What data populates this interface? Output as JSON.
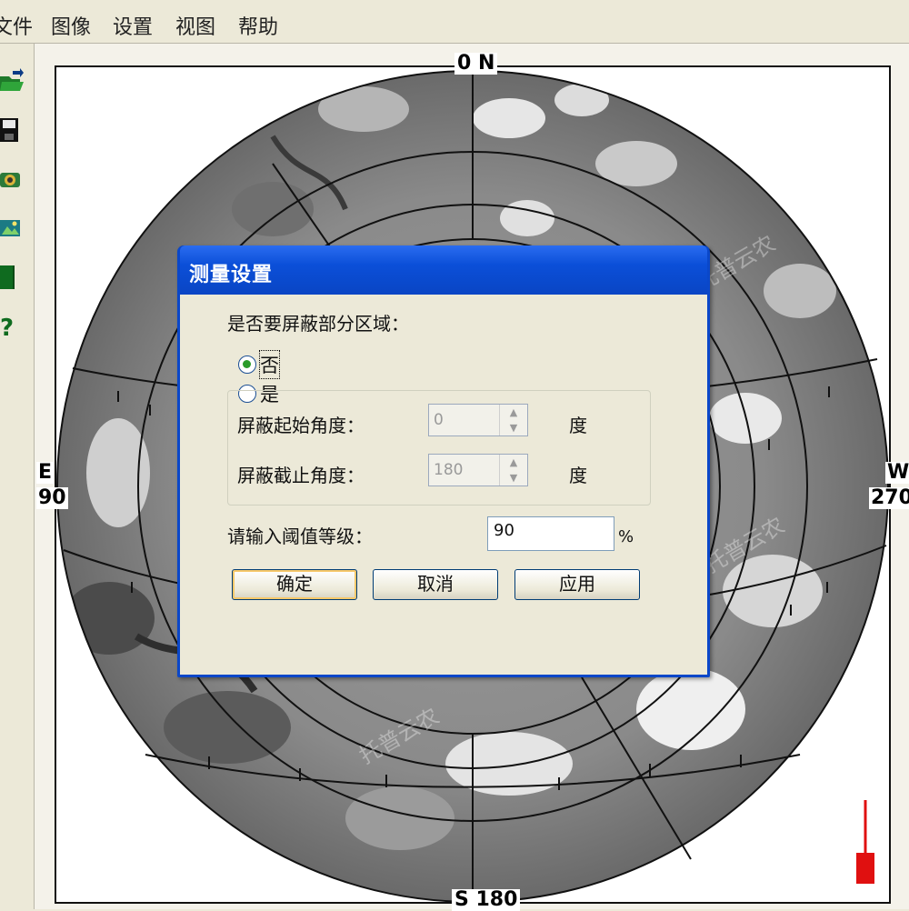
{
  "menubar": {
    "items": [
      "文件",
      "图像",
      "设置",
      "视图",
      "帮助"
    ]
  },
  "toolbar": {
    "icons": [
      "open-folder-icon",
      "save-icon",
      "camera-icon",
      "image-icon",
      "book-icon",
      "help-icon"
    ]
  },
  "plot": {
    "north_label": "0 N",
    "south_label": "S 180",
    "east_letter": "E",
    "east_value": "90",
    "west_letter": "W",
    "west_value": "270"
  },
  "watermark": "托普云农",
  "dialog": {
    "title": "测量设置",
    "question": "是否要屏蔽部分区域：",
    "option_no": "否",
    "option_yes": "是",
    "selected": "否",
    "start_angle_label": "屏蔽起始角度：",
    "start_angle_value": "0",
    "end_angle_label": "屏蔽截止角度：",
    "end_angle_value": "180",
    "degree_unit": "度",
    "threshold_label": "请输入阈值等级：",
    "threshold_value": "90",
    "percent_unit": "%",
    "ok_button": "确定",
    "cancel_button": "取消",
    "apply_button": "应用"
  },
  "colors": {
    "dialog_blue": "#0a47c9",
    "dialog_face": "#ece9d8",
    "meter_red": "#e01010"
  }
}
